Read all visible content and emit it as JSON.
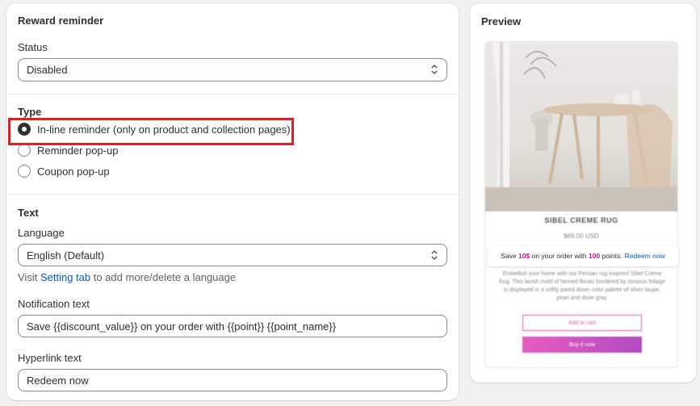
{
  "reward_reminder": {
    "title": "Reward reminder",
    "status_label": "Status",
    "status_value": "Disabled"
  },
  "type": {
    "title": "Type",
    "options": [
      {
        "label": "In-line reminder (only on product and collection pages)",
        "selected": true
      },
      {
        "label": "Reminder pop-up",
        "selected": false
      },
      {
        "label": "Coupon pop-up",
        "selected": false
      }
    ]
  },
  "text": {
    "title": "Text",
    "language_label": "Language",
    "language_value": "English (Default)",
    "help_prefix": "Visit",
    "help_link": "Setting tab",
    "help_suffix": "to add more/delete a language",
    "notification_label": "Notification text",
    "notification_value": "Save {{discount_value}} on your order with {{point}} {{point_name}}",
    "hyperlink_label": "Hyperlink text",
    "hyperlink_value": "Redeem now"
  },
  "preview": {
    "title": "Preview",
    "product_name": "SIBEL CREME RUG",
    "price": "$69.00 USD",
    "reminder_save": "Save",
    "reminder_amount": "10$",
    "reminder_mid": "on your order with",
    "reminder_points": "100",
    "reminder_unit": "points.",
    "reminder_link": "Redeem now",
    "description": "Embellish your home with our Persian rug-inspired Sibel Creme Rug. This lavish motif of fanned florals bordered by sinuous foliage is displayed in a softly pared down color palette of silver taupe, pearl and dove gray.",
    "add_to_cart": "Add to cart",
    "buy_now": "Buy it now"
  },
  "colors": {
    "highlight": "#e02020",
    "link": "#005bd3",
    "accent_pink": "#c2188a"
  },
  "icons": {
    "status_chevron": "select-chevron-icon",
    "language_chevron": "select-chevron-icon"
  }
}
